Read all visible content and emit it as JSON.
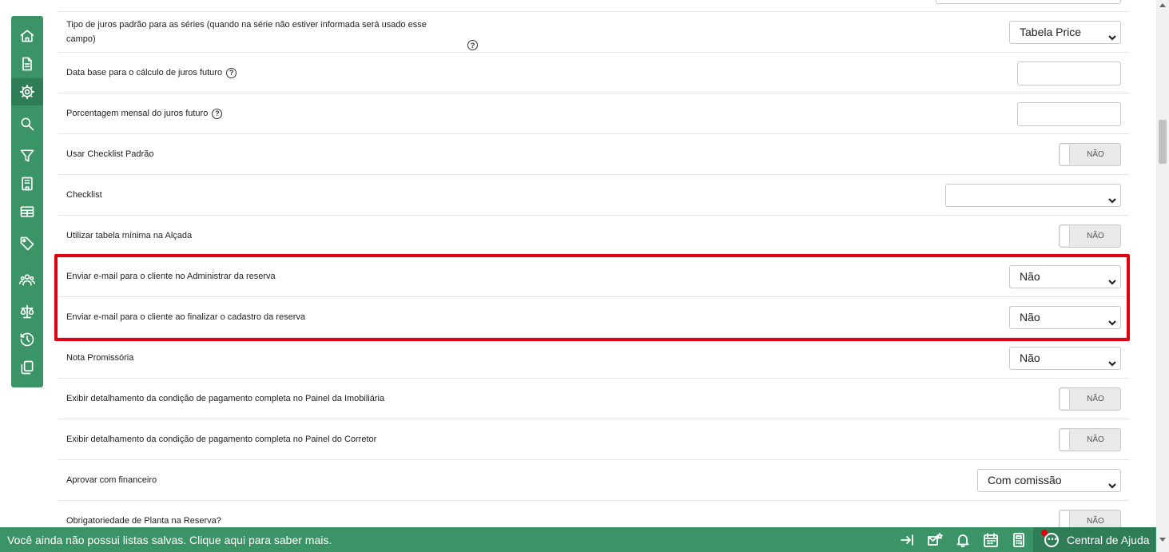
{
  "sidebar": {
    "items": [
      {
        "icon": "home-icon",
        "active": false
      },
      {
        "icon": "document-icon",
        "active": false
      },
      {
        "icon": "gear-icon",
        "active": true
      },
      {
        "icon": "search-icon",
        "active": false
      },
      {
        "icon": "filter-icon",
        "active": false
      },
      {
        "icon": "building-icon",
        "active": false
      },
      {
        "icon": "table-icon",
        "active": false
      },
      {
        "icon": "tag-icon",
        "active": false
      },
      {
        "icon": "users-icon",
        "active": false
      },
      {
        "icon": "scale-icon",
        "active": false
      },
      {
        "icon": "history-icon",
        "active": false
      },
      {
        "icon": "copy-icon",
        "active": false
      }
    ]
  },
  "settings": {
    "rows": [
      {
        "label": "Tipo de juros padrão para as séries (quando na série não estiver informada será usado esse campo)",
        "help": "?",
        "control": "select",
        "value": "Tabela Price"
      },
      {
        "label": "Data base para o cálculo de juros futuro",
        "help": "?",
        "control": "input",
        "value": ""
      },
      {
        "label": "Porcentagem mensal do juros futuro",
        "help": "?",
        "control": "input",
        "value": ""
      },
      {
        "label": "Usar Checklist Padrão",
        "control": "toggle",
        "value": "NÃO"
      },
      {
        "label": "Checklist",
        "control": "select",
        "value": ""
      },
      {
        "label": "Utilizar tabela mínima na Alçada",
        "control": "toggle",
        "value": "NÃO"
      },
      {
        "label": "Enviar e-mail para o cliente no Administrar da reserva",
        "control": "select",
        "value": "Não",
        "highlighted": true
      },
      {
        "label": "Enviar e-mail para o cliente ao finalizar o cadastro da reserva",
        "control": "select",
        "value": "Não",
        "highlighted": true
      },
      {
        "label": "Nota Promissória",
        "control": "select",
        "value": "Não"
      },
      {
        "label": "Exibir detalhamento da condição de pagamento completa no Painel da Imobiliária",
        "control": "toggle",
        "value": "NÃO"
      },
      {
        "label": "Exibir detalhamento da condição de pagamento completa no Painel do Corretor",
        "control": "toggle",
        "value": "NÃO"
      },
      {
        "label": "Aprovar com financeiro",
        "control": "select",
        "value": "Com comissão"
      },
      {
        "label": "Obrigatoriedade de Planta na Reserva?",
        "control": "toggle",
        "value": "NÃO"
      }
    ]
  },
  "bottom_bar": {
    "message": "Você ainda não possui listas salvas. Clique aqui para saber mais.",
    "icons": [
      "collapse-right-icon",
      "mail-star-icon",
      "bell-icon",
      "calendar-icon",
      "calculator-icon"
    ],
    "help_center_label": "Central de Ajuda"
  },
  "colors": {
    "brand_green": "#3a9466",
    "brand_green_dark": "#2f7d56",
    "highlight_red": "#e0000f"
  }
}
